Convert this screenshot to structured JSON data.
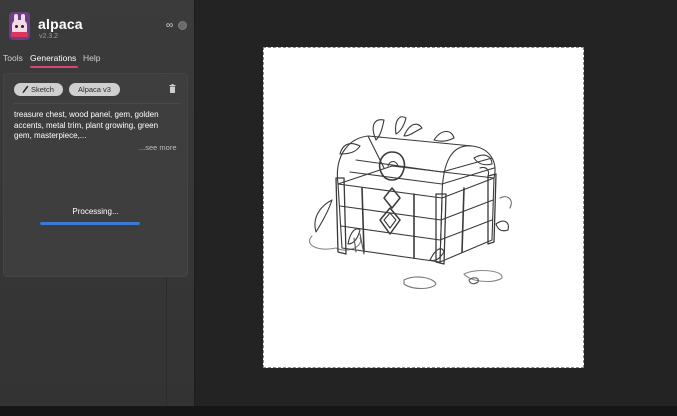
{
  "app": {
    "name": "alpaca",
    "version": "v2.3.2",
    "header_icons": [
      "infinity-icon",
      "status-dot"
    ]
  },
  "nav": {
    "tabs": [
      {
        "label": "Tools",
        "active": false
      },
      {
        "label": "Generations",
        "active": true
      },
      {
        "label": "Help",
        "active": false
      }
    ]
  },
  "generation": {
    "mode_chip": {
      "label": "Sketch",
      "icon": "pencil-icon"
    },
    "model_chip": {
      "label": "Alpaca v3"
    },
    "delete_icon": "trash-icon",
    "prompt": "treasure chest, wood panel, gem, golden accents, metal trim, plant growing, green gem, masterpiece,...",
    "see_more": "...see more",
    "status": "Processing...",
    "progress": 1.0
  },
  "canvas": {
    "content": "sketch-drawing"
  },
  "colors": {
    "accent_underline": "#d94470",
    "progress": "#3a7bd5",
    "panel_bg": "#3b3b3b",
    "workspace_bg": "#232323"
  }
}
